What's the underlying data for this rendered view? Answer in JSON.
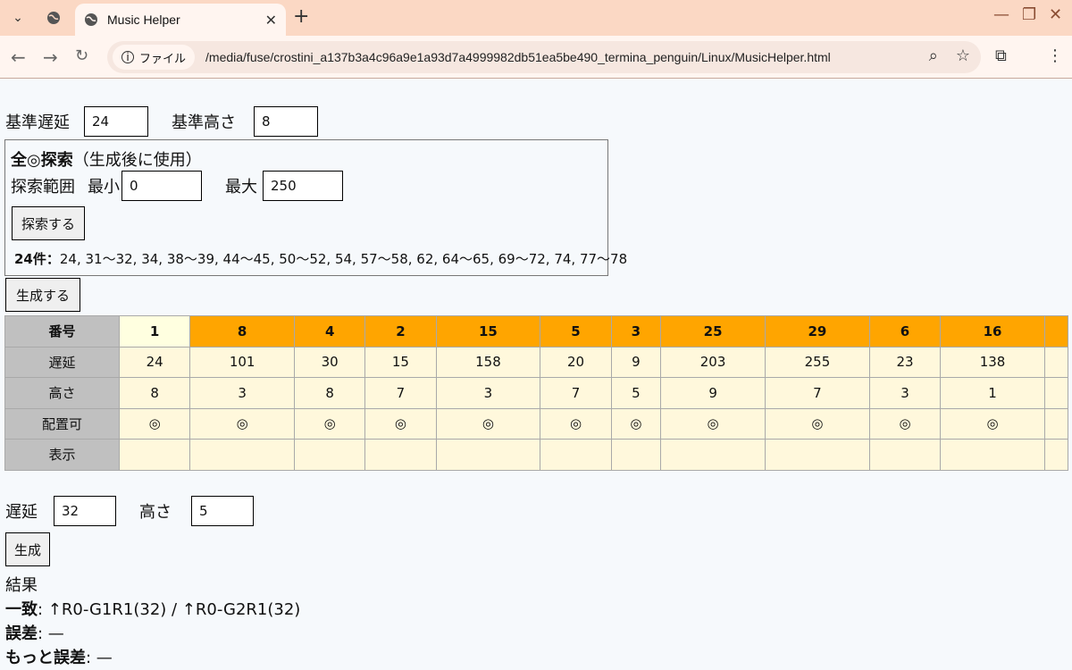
{
  "browser": {
    "tab_title": "Music Helper",
    "chip_label": "ファイル",
    "url": "/media/fuse/crostini_a137b3a4c96a9e1a93d7a4999982db51ea5be490_termina_penguin/Linux/MusicHelper.html"
  },
  "base": {
    "delay_label": "基準遅延",
    "delay_value": "24",
    "height_label": "基準高さ",
    "height_value": "8"
  },
  "search": {
    "title_bold": "全◎探索",
    "title_note": "（生成後に使用）",
    "range_label": "探索範囲",
    "min_label": "最小",
    "min_value": "0",
    "max_label": "最大",
    "max_value": "250",
    "button_label": "探索する",
    "result_count": "24件：",
    "result_values": "24, 31〜32, 34, 38〜39, 44〜45, 50〜52, 54, 57〜58, 62, 64〜65, 69〜72, 74, 77〜78"
  },
  "generate_button": "生成する",
  "table": {
    "row_headers": [
      "番号",
      "遅延",
      "高さ",
      "配置可",
      "表示"
    ],
    "columns": [
      {
        "num": "1",
        "delay": "24",
        "height": "8",
        "ok": "◎"
      },
      {
        "num": "8",
        "delay": "101",
        "height": "3",
        "ok": "◎"
      },
      {
        "num": "4",
        "delay": "30",
        "height": "8",
        "ok": "◎"
      },
      {
        "num": "2",
        "delay": "15",
        "height": "7",
        "ok": "◎"
      },
      {
        "num": "15",
        "delay": "158",
        "height": "3",
        "ok": "◎"
      },
      {
        "num": "5",
        "delay": "20",
        "height": "7",
        "ok": "◎"
      },
      {
        "num": "3",
        "delay": "9",
        "height": "5",
        "ok": "◎"
      },
      {
        "num": "25",
        "delay": "203",
        "height": "9",
        "ok": "◎"
      },
      {
        "num": "29",
        "delay": "255",
        "height": "7",
        "ok": "◎"
      },
      {
        "num": "6",
        "delay": "23",
        "height": "3",
        "ok": "◎"
      },
      {
        "num": "16",
        "delay": "138",
        "height": "1",
        "ok": "◎"
      }
    ]
  },
  "lower": {
    "delay_label": "遅延",
    "delay_value": "32",
    "height_label": "高さ",
    "height_value": "5",
    "button_label": "生成",
    "result_label": "結果",
    "match_label": "一致",
    "match_value": ": ↑R0-G1R1(32) / ↑R0-G2R1(32)",
    "error_label": "誤差",
    "error_value": ": —",
    "more_error_label": "もっと誤差",
    "more_error_value": ": —"
  }
}
